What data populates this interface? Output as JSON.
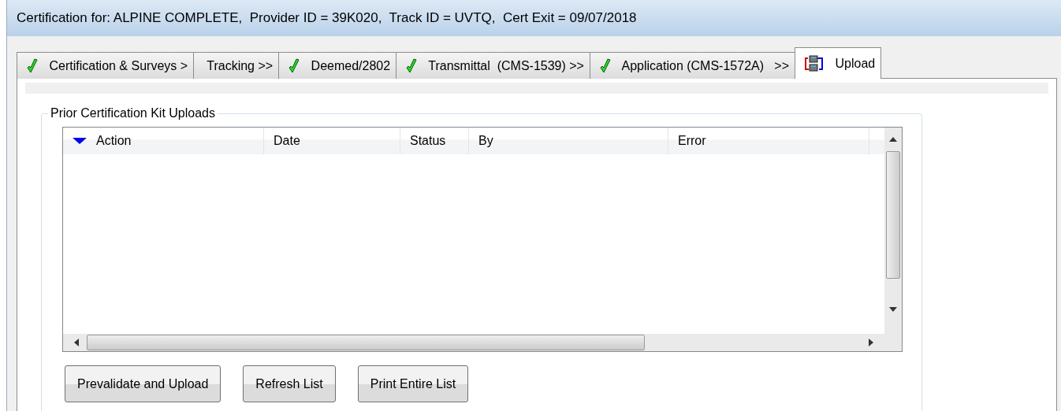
{
  "window": {
    "title": "Certification for: ALPINE COMPLETE,  Provider ID = 39K020,  Track ID = UVTQ,  Cert Exit = 09/07/2018"
  },
  "tabs": [
    {
      "label": "Certification & Surveys >",
      "kind": "check",
      "selected": false
    },
    {
      "label": "Tracking >>",
      "kind": "plain",
      "selected": false
    },
    {
      "label": "Deemed/2802",
      "kind": "check",
      "selected": false
    },
    {
      "label": "Transmittal  (CMS-1539) >>",
      "kind": "check",
      "selected": false
    },
    {
      "label": "Application (CMS-1572A)   >>",
      "kind": "check",
      "selected": false
    },
    {
      "label": "Upload",
      "kind": "upload",
      "selected": true
    }
  ],
  "group": {
    "title": "Prior Certification Kit Uploads",
    "table": {
      "columns": [
        {
          "label": "Action",
          "sorted": true
        },
        {
          "label": "Date",
          "sorted": false
        },
        {
          "label": "Status",
          "sorted": false
        },
        {
          "label": "By",
          "sorted": false
        },
        {
          "label": "Error",
          "sorted": false
        }
      ]
    },
    "buttons": [
      "Prevalidate and Upload",
      "Refresh List",
      "Print Entire List"
    ]
  }
}
